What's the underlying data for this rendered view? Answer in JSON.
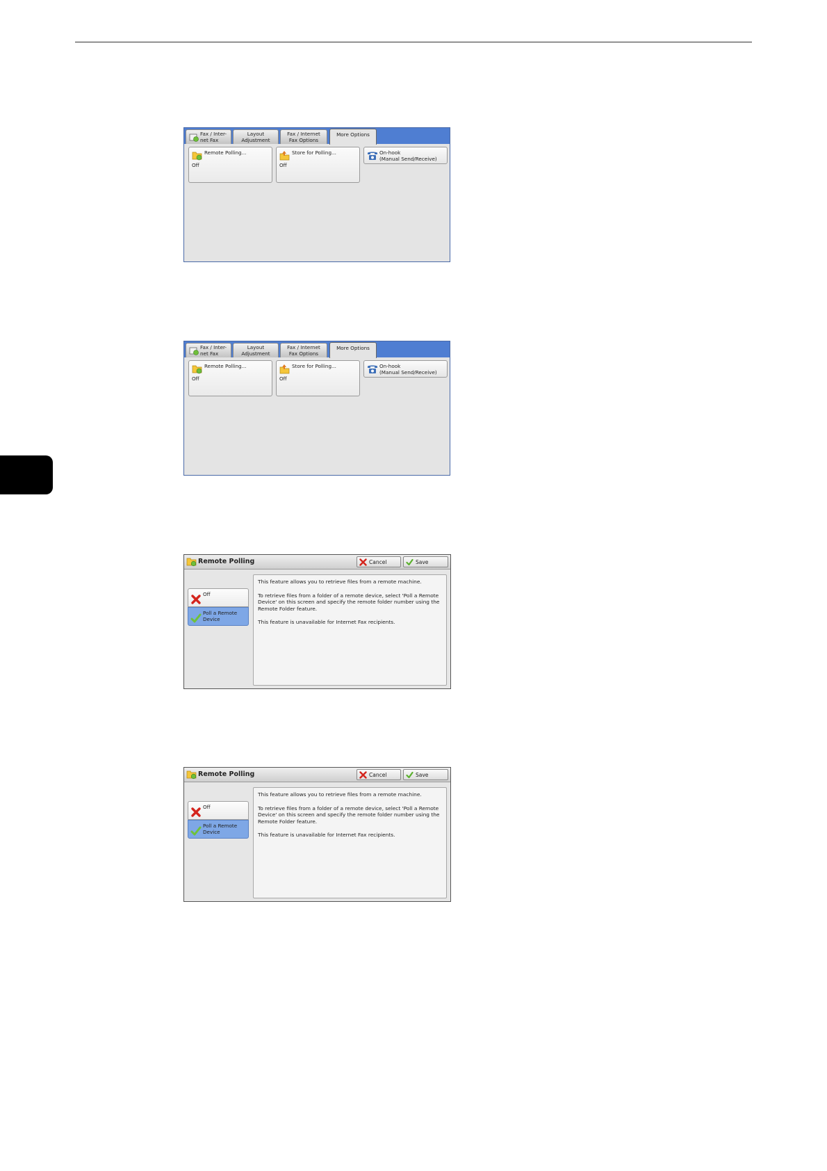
{
  "fax_screen": {
    "tabs": [
      "Fax / Inter-\nnet Fax",
      "Layout\nAdjustment",
      "Fax / Internet\nFax Options",
      "More Options"
    ],
    "active_tab": "More Options",
    "buttons": {
      "remote_polling": {
        "label": "Remote Polling...",
        "value": "Off"
      },
      "store_for_polling": {
        "label": "Store for Polling...",
        "value": "Off"
      },
      "on_hook": {
        "label_line1": "On-hook",
        "label_line2": "(Manual Send/Receive)"
      }
    }
  },
  "remote_polling_dialog": {
    "title": "Remote Polling",
    "cancel_label": "Cancel",
    "save_label": "Save",
    "options": {
      "off": "Off",
      "poll": "Poll a Remote\nDevice"
    },
    "selected_option": "Poll a Remote Device",
    "description": [
      "This feature allows you to retrieve files from a remote machine.",
      "To retrieve files from a folder of a remote device, select 'Poll a Remote Device' on this screen and specify the remote folder number using the Remote Folder feature.",
      "This feature is unavailable for Internet Fax recipients."
    ]
  },
  "colors": {
    "tab_bar": "#4f7ed2",
    "selected_option": "#7ea7e6",
    "page_tab": "#000000"
  },
  "icons": [
    "remote-polling-folder-icon",
    "store-for-polling-icon",
    "on-hook-phone-icon",
    "cancel-x-icon",
    "save-check-icon",
    "off-x-icon",
    "poll-check-icon"
  ]
}
